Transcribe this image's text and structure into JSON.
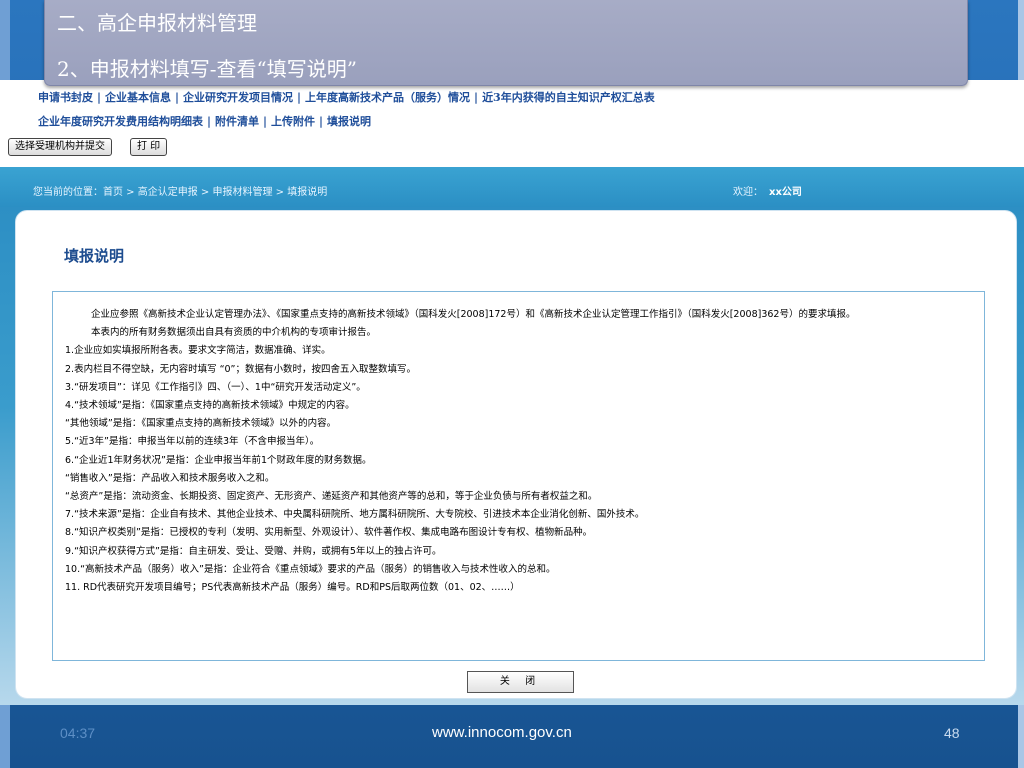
{
  "slide": {
    "title_line1": "二、高企申报材料管理",
    "title_line2": "2、申报材料填写-查看“填写说明”",
    "footer_time": "04:37",
    "footer_url": "www.innocom.gov.cn",
    "footer_page": "48"
  },
  "nav": {
    "row1": [
      "申请书封皮",
      "企业基本信息",
      "企业研究开发项目情况",
      "上年度高新技术产品（服务）情况",
      "近3年内获得的自主知识产权汇总表"
    ],
    "row2": [
      "企业年度研究开发费用结构明细表",
      "附件清单",
      "上传附件",
      "填报说明"
    ]
  },
  "toolbar": {
    "submit_label": "选择受理机构并提交",
    "print_label": "打 印"
  },
  "location": {
    "breadcrumb": "您当前的位置：首页 > 高企认定申报 > 申报材料管理 > 填报说明",
    "welcome_label": "欢迎：",
    "company": "xx公司"
  },
  "panel": {
    "title": "填报说明",
    "close_label": "关 闭",
    "notes": [
      "企业应参照《高新技术企业认定管理办法》、《国家重点支持的高新技术领域》（国科发火[2008]172号）和《高新技术企业认定管理工作指引》（国科发火[2008]362号）的要求填报。",
      "本表内的所有财务数据须出自具有资质的中介机构的专项审计报告。",
      "1.企业应如实填报所附各表。要求文字简洁，数据准确、详实。",
      "2.表内栏目不得空缺，无内容时填写 “0”；数据有小数时，按四舍五入取整数填写。",
      "3.“研发项目”：详见《工作指引》四、（一）、1中“研究开发活动定义”。",
      "4.“技术领域”是指：《国家重点支持的高新技术领域》中规定的内容。",
      "“其他领域”是指：《国家重点支持的高新技术领域》以外的内容。",
      "5.“近3年”是指：申报当年以前的连续3年（不含申报当年）。",
      "6.“企业近1年财务状况”是指：企业申报当年前1个财政年度的财务数据。",
      "“销售收入”是指：产品收入和技术服务收入之和。",
      "“总资产”是指：流动资金、长期投资、固定资产、无形资产、递延资产和其他资产等的总和，等于企业负债与所有者权益之和。",
      "7.“技术来源”是指：企业自有技术、其他企业技术、中央属科研院所、地方属科研院所、大专院校、引进技术本企业消化创新、国外技术。",
      "8.“知识产权类别”是指：已授权的专利（发明、实用新型、外观设计）、软件著作权、集成电路布图设计专有权、植物新品种。",
      "9.“知识产权获得方式”是指：自主研发、受让、受赠、并购，或拥有5年以上的独占许可。",
      "10.“高新技术产品（服务）收入”是指：企业符合《重点领域》要求的产品（服务）的销售收入与技术性收入的总和。",
      "11. RD代表研究开发项目编号；PS代表高新技术产品（服务）编号。RD和PS后取两位数（01、02、……）"
    ]
  }
}
